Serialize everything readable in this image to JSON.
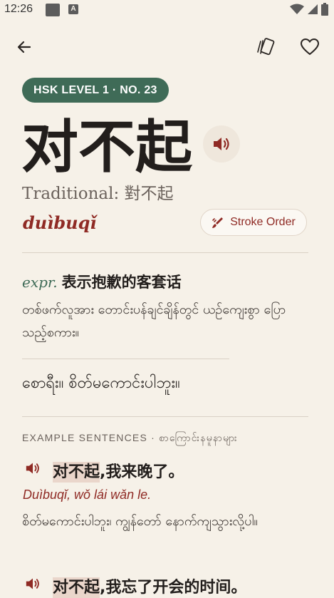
{
  "status_bar": {
    "time": "12:26"
  },
  "word": {
    "badge": "HSK LEVEL 1 · NO. 23",
    "hanzi": "对不起",
    "traditional": "Traditional: 對不起",
    "pinyin": "duìbuqǐ",
    "stroke_order_label": "Stroke Order"
  },
  "definition": {
    "pos": "expr.",
    "zh": "表示抱歉的客套话",
    "my": "တစ်ဖက်လူအား တောင်းပန်ချင်ချိန်တွင် ယဉ်ကျေးစွာ ပြောသည့်စကား။"
  },
  "phrase": "စောရီး။ စိတ်မကောင်းပါဘူး။",
  "examples": {
    "header": "EXAMPLE SENTENCES · စာကြောင်းနမူနာများ",
    "items": [
      {
        "highlight": "对不起",
        "rest": ",我来晚了。",
        "pinyin": "Duìbuqǐ, wǒ lái wǎn le.",
        "translation": "စိတ်မကောင်းပါဘူး၊ ကျွန်တော် နောက်ကျသွားလို့ပါ။"
      },
      {
        "highlight": "对不起",
        "rest": ",我忘了开会的时间。"
      }
    ]
  },
  "colors": {
    "accent_green": "#3f6b57",
    "accent_red": "#8f2a24",
    "background": "#f6f1e8"
  },
  "icons": [
    "back-arrow-icon",
    "flashcards-icon",
    "heart-icon",
    "speaker-icon",
    "brush-icon"
  ]
}
